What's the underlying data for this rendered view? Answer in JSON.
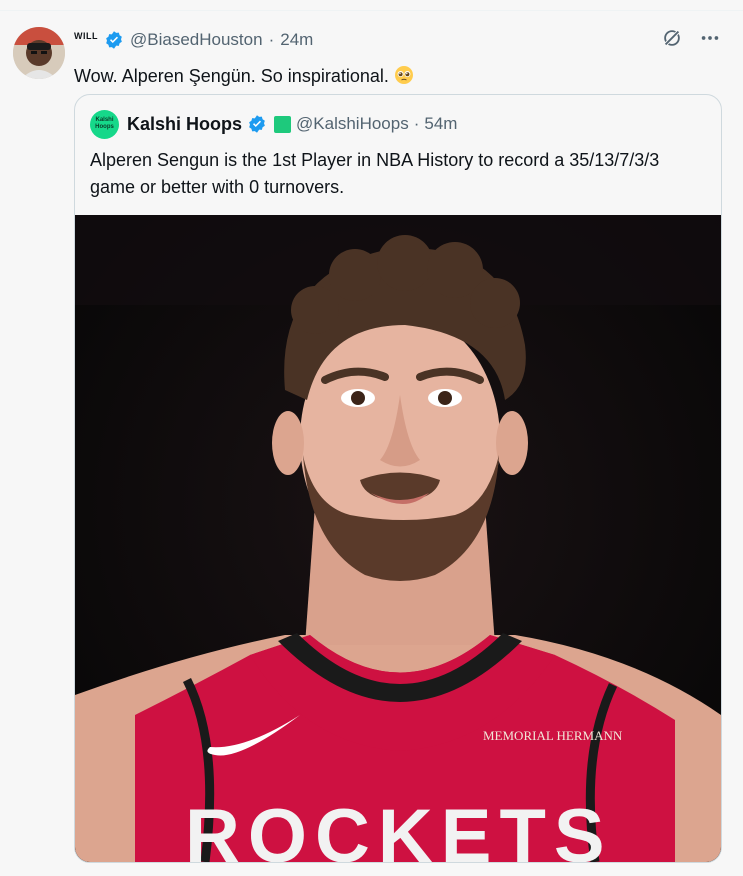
{
  "tweet": {
    "display_name": "WILL",
    "handle": "@BiasedHouston",
    "separator": "·",
    "time": "24m",
    "text": "Wow. Alperen Şengün. So inspirational.",
    "emoji": "pleading-face-emoji"
  },
  "quote": {
    "avatar_line1": "Kalshi",
    "avatar_line2": "Hoops",
    "display_name": "Kalshi Hoops",
    "handle": "@KalshiHoops",
    "separator": "·",
    "time": "54m",
    "text_line1": "Alperen Sengun is the 1st Player in NBA History to record a 35/13/7/3/3",
    "text_line2": "game or better with 0 turnovers.",
    "photo_jersey_sponsor": "MEMORIAL HERMANN",
    "photo_jersey_text": "ROCKETS"
  },
  "colors": {
    "verified": "#1d9bf0",
    "kalshi": "#16d88a",
    "jersey": "#ce1141"
  },
  "icons": [
    "verified-badge-icon",
    "grok-icon",
    "more-icon",
    "pleading-face-emoji"
  ]
}
